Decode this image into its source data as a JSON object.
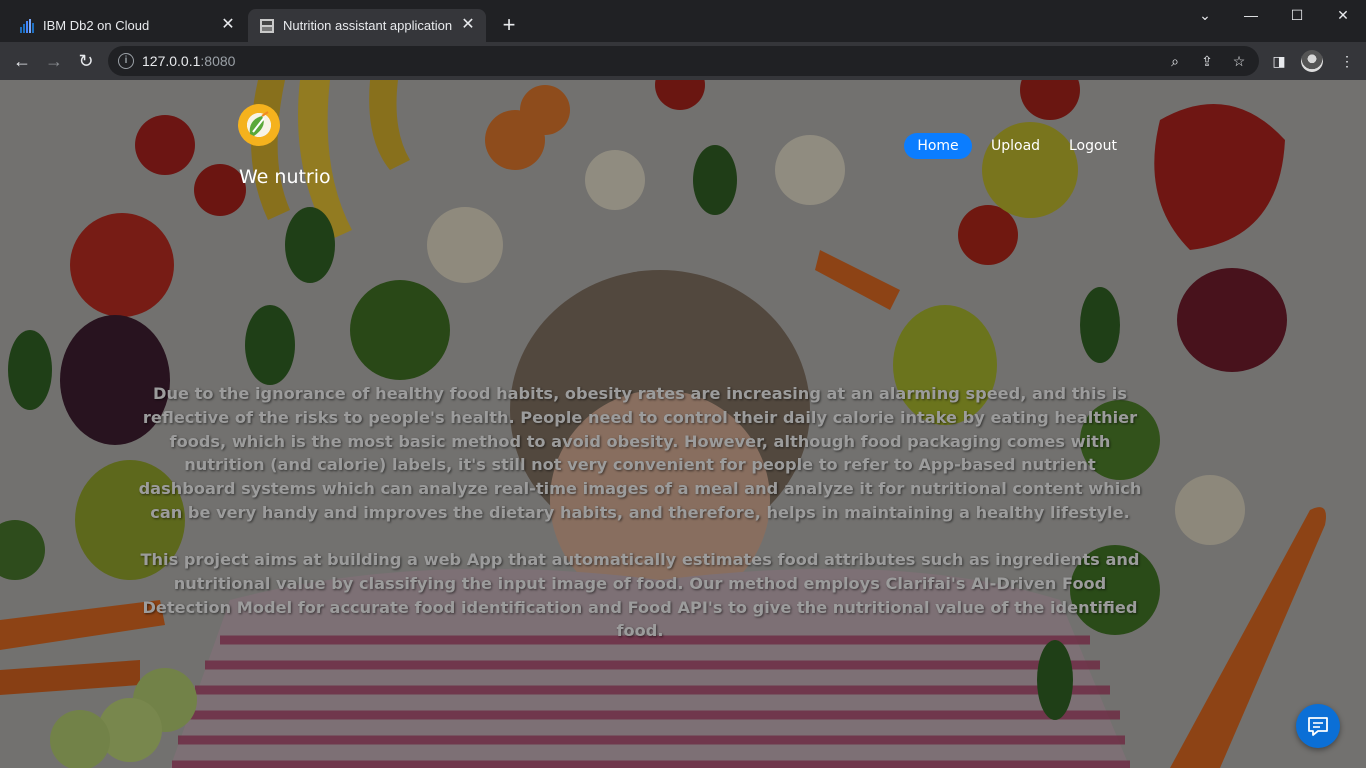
{
  "browser": {
    "tabs": [
      {
        "title": "IBM Db2 on Cloud",
        "icon": "ibm-db2-icon"
      },
      {
        "title": "Nutrition assistant application",
        "icon": "app-favicon-icon"
      }
    ],
    "new_tab": "+",
    "url_host": "127.0.0.1",
    "url_port": ":8080"
  },
  "site": {
    "brand": "We nutrio",
    "nav": {
      "home": "Home",
      "upload": "Upload",
      "logout": "Logout"
    },
    "paragraph1": "Due to the ignorance of healthy food habits, obesity rates are increasing at an alarming speed, and this is reflective of the risks to people's health. People need to control their daily calorie intake by eating healthier foods, which is the most basic method to avoid obesity. However, although food packaging comes with nutrition (and calorie) labels, it's still not very convenient for people to refer to App-based nutrient dashboard systems which can analyze real-time images of a meal and analyze it for nutritional content which can be very handy and improves the dietary habits, and therefore, helps in maintaining a healthy lifestyle.",
    "paragraph2": "This project aims at building a web App that automatically estimates food attributes such as ingredients and nutritional value by classifying the input image of food.  Our method employs Clarifai's AI-Driven Food Detection Model for accurate food identification and Food API's to give the nutritional value of the identified food."
  },
  "colors": {
    "nav_active": "#0b7dff",
    "chat_button": "#0b6fd6",
    "chrome_bg": "#202124",
    "chrome_toolbar": "#35363a"
  }
}
